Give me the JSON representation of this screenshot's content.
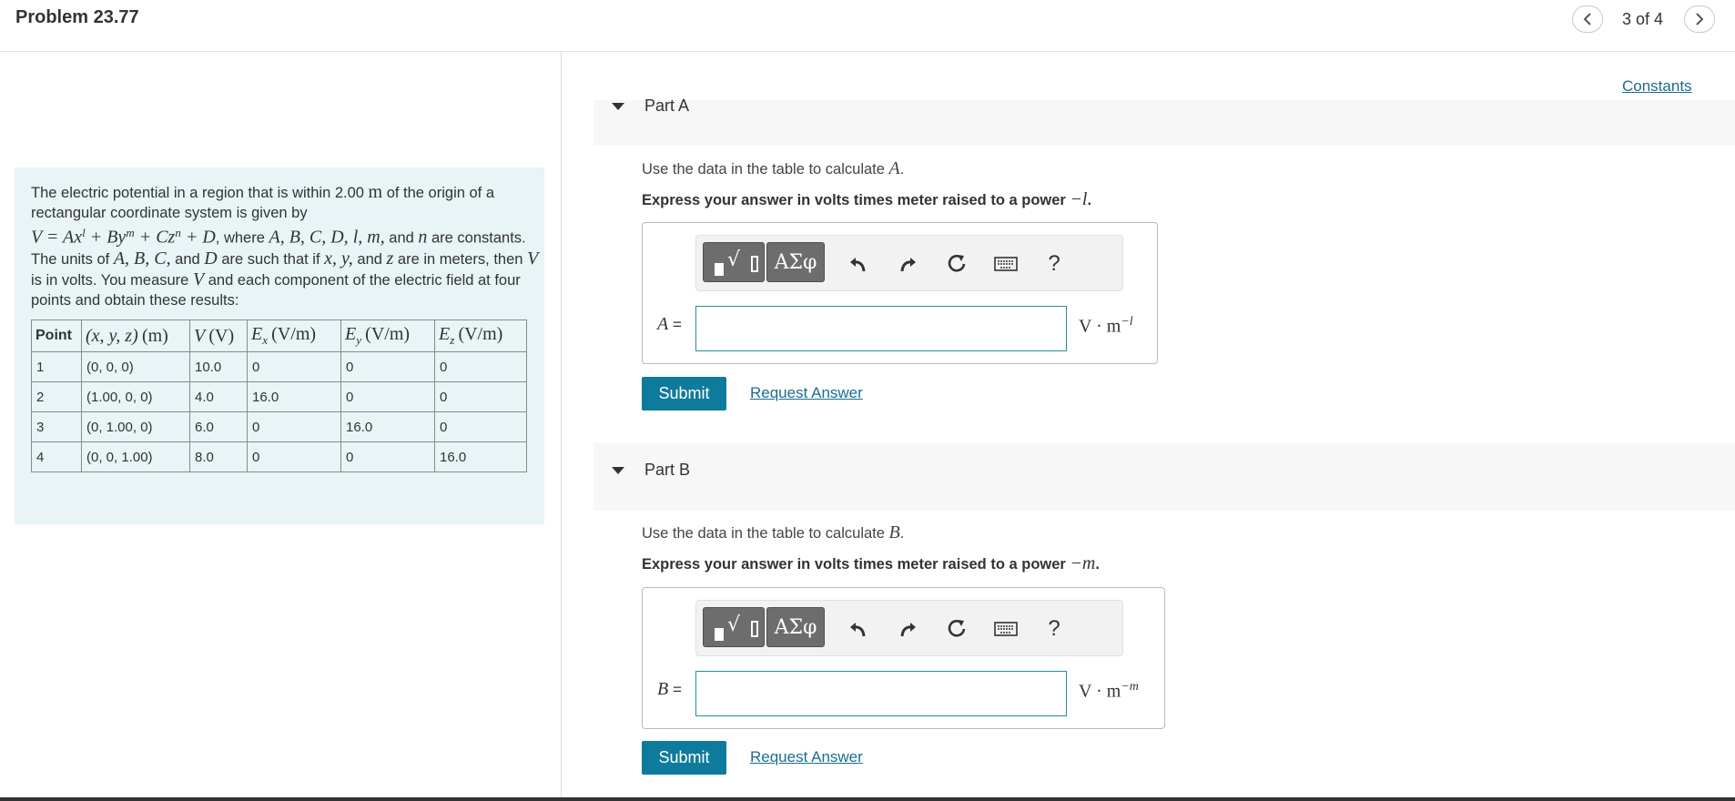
{
  "header": {
    "title": "Problem 23.77",
    "counter": "3 of 4",
    "prev_icon": "chevron-left-icon",
    "next_icon": "chevron-right-icon"
  },
  "problem": {
    "t1": "The electric potential in a region that is within 2.00 ",
    "m_unit": "m",
    "t2": " of the origin of a rectangular coordinate system is given by",
    "formula": "V = Ax",
    "sup_l": "l",
    "formula_b": " + By",
    "sup_m": "m",
    "formula_c": " + Cz",
    "sup_n": "n",
    "formula_d": " + D",
    "t3": ", where ",
    "consts": "A, B, C, D, l, m,",
    "t4": " and ",
    "n": "n",
    "t5": " are constants. The units of ",
    "abc": "A, B, C,",
    "t6": " and ",
    "d": "D",
    "t7": " are such that if ",
    "xy": "x, y,",
    "t8": " and ",
    "z": "z",
    "t9": " are in meters, then ",
    "v1": "V",
    "t10": " is in volts. You measure ",
    "v2": "V",
    "t11": " and each component of the electric field at four points and obtain these results:"
  },
  "table": {
    "headers": [
      "Point",
      "(x, y, z) (m)",
      "V (V)",
      "Ex (V/m)",
      "Ey (V/m)",
      "Ez (V/m)"
    ],
    "rows": [
      [
        "1",
        "(0, 0, 0)",
        "10.0",
        "0",
        "0",
        "0"
      ],
      [
        "2",
        "(1.00, 0, 0)",
        "4.0",
        "16.0",
        "0",
        "0"
      ],
      [
        "3",
        "(0, 1.00, 0)",
        "6.0",
        "0",
        "16.0",
        "0"
      ],
      [
        "4",
        "(0, 0, 1.00)",
        "8.0",
        "0",
        "0",
        "16.0"
      ]
    ]
  },
  "constants_link": "Constants",
  "partA": {
    "title": "Part A",
    "instr_pre": "Use the data in the table to calculate ",
    "instr_var": "A",
    "instr_post": ".",
    "express_pre": "Express your answer in volts times meter raised to a power ",
    "express_pow": "−l",
    "express_post": ".",
    "var": "A",
    "eq": " =",
    "value": "",
    "unit": "V · m",
    "unit_pow": "−l",
    "submit": "Submit",
    "request": "Request Answer"
  },
  "partB": {
    "title": "Part B",
    "instr_pre": "Use the data in the table to calculate ",
    "instr_var": "B",
    "instr_post": ".",
    "express_pre": "Express your answer in volts times meter raised to a power ",
    "express_pow": "−m",
    "express_post": ".",
    "var": "B",
    "eq": " =",
    "value": "",
    "unit": "V · m",
    "unit_pow": "−m",
    "submit": "Submit",
    "request": "Request Answer"
  },
  "toolbar": {
    "greek": "ΑΣφ",
    "help": "?"
  },
  "colors": {
    "accent": "#0f7b9c",
    "link": "#1a6d8e",
    "problem_bg": "#e8f4f5",
    "input_border": "#2a8a9e"
  }
}
